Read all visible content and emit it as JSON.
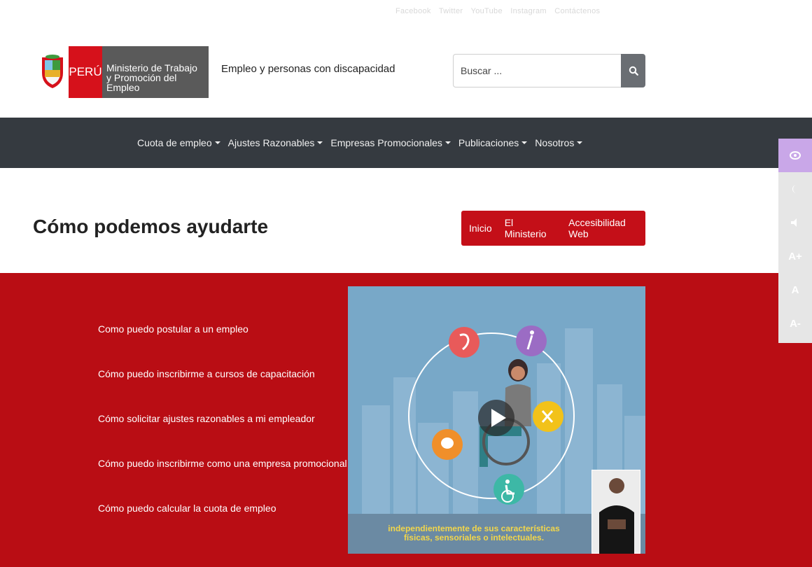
{
  "topbar": {
    "links": [
      "Facebook",
      "Twitter",
      "YouTube",
      "Instagram",
      "Contáctenos"
    ]
  },
  "header": {
    "country": "PERÚ",
    "ministry_line1": "Ministerio de Trabajo",
    "ministry_line2": "y Promoción del Empleo",
    "site_title": "Empleo y personas con discapacidad",
    "search_placeholder": "Buscar ...",
    "search_icon": "search-icon"
  },
  "nav": {
    "items": [
      {
        "label": "Cuota de empleo"
      },
      {
        "label": "Ajustes Razonables"
      },
      {
        "label": "Empresas Promocionales"
      },
      {
        "label": "Publicaciones"
      },
      {
        "label": "Nosotros"
      }
    ]
  },
  "page": {
    "title": "Cómo podemos ayudarte",
    "breadcrumb": [
      "Inicio",
      "El Ministerio",
      "Accesibilidad Web"
    ]
  },
  "help_links": [
    "Como puedo postular a un empleo",
    "Cómo puedo inscribirme a cursos de capacitación",
    "Cómo solicitar ajustes razonables a mi empleador",
    "Cómo puedo inscribirme como una empresa promocional",
    "Cómo puedo calcular la cuota de empleo"
  ],
  "video": {
    "caption_line1": "independientemente de sus características",
    "caption_line2": "físicas, sensoriales o intelectuales.",
    "play_icon": "play-icon"
  },
  "accessibility": {
    "buttons": [
      {
        "icon": "eye-icon",
        "label": ""
      },
      {
        "icon": "contrast-icon",
        "label": ""
      },
      {
        "icon": "audio-icon",
        "label": ""
      },
      {
        "icon": "font-increase-icon",
        "label": "A+"
      },
      {
        "icon": "font-reset-icon",
        "label": "A"
      },
      {
        "icon": "font-decrease-icon",
        "label": "A-"
      }
    ]
  },
  "colors": {
    "brand_red": "#c40f18",
    "section_red": "#b90d14",
    "nav_dark": "#353a40",
    "accent_purple": "#c9a7e8"
  }
}
